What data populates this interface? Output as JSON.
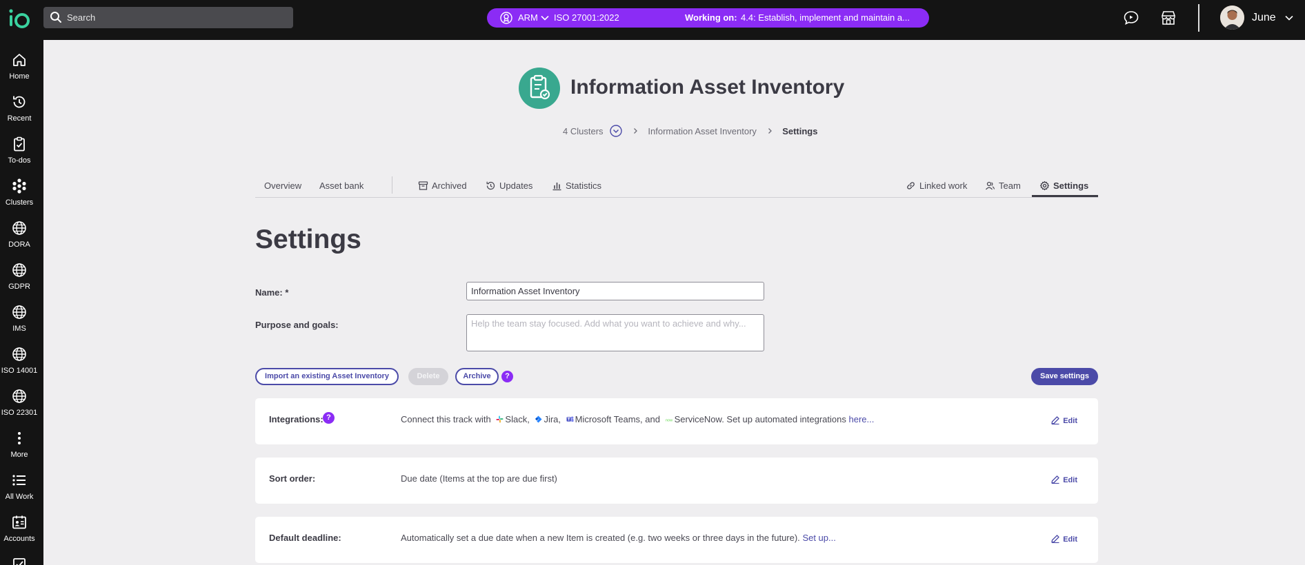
{
  "topbar": {
    "search_placeholder": "Search",
    "standard_short": "ARM",
    "standard": "ISO 27001:2022",
    "working_on_label": "Working on:",
    "working_on_text": "4.4: Establish, implement and maintain a...",
    "user_name": "June"
  },
  "rail": [
    {
      "label": "Home",
      "icon": "home-icon"
    },
    {
      "label": "Recent",
      "icon": "history-icon"
    },
    {
      "label": "To-dos",
      "icon": "clipboard-check-icon"
    },
    {
      "label": "Clusters",
      "icon": "clusters-icon"
    },
    {
      "label": "DORA",
      "icon": "globe-icon"
    },
    {
      "label": "GDPR",
      "icon": "globe-icon"
    },
    {
      "label": "IMS",
      "icon": "globe-icon"
    },
    {
      "label": "ISO 14001",
      "icon": "globe-icon"
    },
    {
      "label": "ISO 22301",
      "icon": "globe-icon"
    },
    {
      "label": "More",
      "icon": "more-vertical-icon"
    },
    {
      "label": "All Work",
      "icon": "list-icon"
    },
    {
      "label": "Accounts",
      "icon": "accounts-icon"
    }
  ],
  "header": {
    "title": "Information Asset Inventory",
    "breadcrumb": {
      "clusters": "4 Clusters",
      "parent": "Information Asset Inventory",
      "current": "Settings"
    }
  },
  "tabs": {
    "overview": "Overview",
    "asset_bank": "Asset bank",
    "archived": "Archived",
    "updates": "Updates",
    "statistics": "Statistics",
    "linked_work": "Linked work",
    "team": "Team",
    "settings": "Settings"
  },
  "settings": {
    "heading": "Settings",
    "name_label": "Name: *",
    "name_value": "Information Asset Inventory",
    "purpose_label": "Purpose and goals:",
    "purpose_placeholder": "Help the team stay focused. Add what you want to achieve and why...",
    "import_button": "Import an existing Asset Inventory",
    "delete_button": "Delete",
    "archive_button": "Archive",
    "help_mark": "?",
    "save_button": "Save settings"
  },
  "cards": {
    "integrations": {
      "label": "Integrations:",
      "text_prefix": "Connect this track with",
      "slack": "Slack,",
      "jira": "Jira,",
      "teams": "Microsoft Teams, and",
      "servicenow": "ServiceNow. Set up automated integrations",
      "link": "here...",
      "edit": "Edit"
    },
    "sort_order": {
      "label": "Sort order:",
      "text": "Due date (Items at the top are due first)",
      "edit": "Edit"
    },
    "default_deadline": {
      "label": "Default deadline:",
      "text": "Automatically set a due date when a new Item is created (e.g. two weeks or three days in the future).",
      "link": "Set up...",
      "edit": "Edit"
    }
  },
  "colors": {
    "accent": "#4b4aa8",
    "working_on": "#8b2cf5",
    "brand_green": "#39a88f"
  }
}
